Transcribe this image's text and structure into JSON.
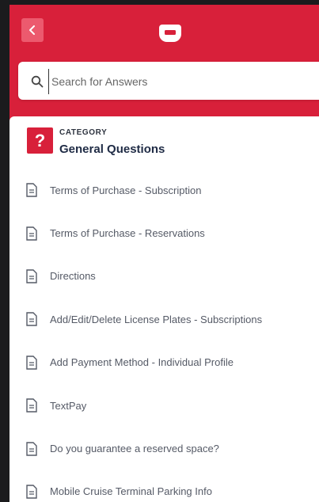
{
  "header": {
    "back_icon": "chevron-left-icon",
    "logo_icon": "brand-logo-icon",
    "brand_color": "#d8203a"
  },
  "search": {
    "placeholder": "Search for Answers",
    "icon": "search-icon"
  },
  "category": {
    "icon_glyph": "?",
    "label": "CATEGORY",
    "title": "General Questions"
  },
  "articles": [
    {
      "title": "Terms of Purchase - Subscription"
    },
    {
      "title": "Terms of Purchase - Reservations"
    },
    {
      "title": "Directions"
    },
    {
      "title": "Add/Edit/Delete License Plates - Subscriptions"
    },
    {
      "title": "Add Payment Method - Individual Profile"
    },
    {
      "title": "TextPay"
    },
    {
      "title": "Do you guarantee a reserved space?"
    },
    {
      "title": "Mobile Cruise Terminal Parking Info"
    }
  ]
}
